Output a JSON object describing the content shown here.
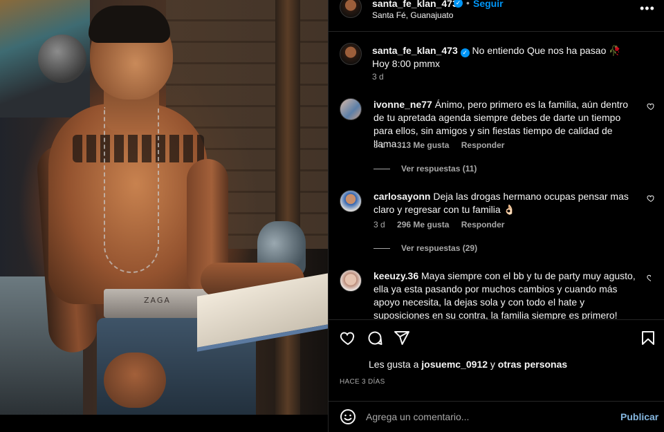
{
  "header": {
    "username": "santa_fe_klan_473",
    "verified_icon": "verified-badge-icon",
    "separator": "•",
    "follow_label": "Seguir",
    "location": "Santa Fé, Guanajuato",
    "more_icon": "more-options-icon",
    "more_glyph": "•••"
  },
  "photo": {
    "brand_text": "ZAGA"
  },
  "caption": {
    "username": "santa_fe_klan_473",
    "text_line1": "No entiendo Que nos ha pasao 🥀",
    "text_line2": "Hoy 8:00 pmmx",
    "time": "3 d"
  },
  "comments": [
    {
      "username": "ivonne_ne77",
      "text": "Ánimo, pero primero es la familia, aún dentro de tu apretada agenda siempre debes de darte un tiempo para ellos, sin amigos y sin fiestas tiempo de calidad de llama...",
      "time": "3 d",
      "likes": "313 Me gusta",
      "reply": "Responder",
      "view_replies": "Ver respuestas (11)"
    },
    {
      "username": "carlosayonn",
      "text": "Deja las drogas hermano ocupas pensar mas claro y regresar con tu familia 👌🏻",
      "time": "3 d",
      "likes": "296 Me gusta",
      "reply": "Responder",
      "view_replies": "Ver respuestas (29)"
    },
    {
      "username": "keeuzy.36",
      "text": "Maya siempre con el bb y tu de party muy agusto, ella ya esta pasando por muchos cambios y cuando más apoyo necesita, la dejas sola y con todo el hate y suposiciones en su contra, la familia siempre es primero!"
    }
  ],
  "actions": {
    "like_icon": "heart-icon",
    "comment_icon": "comment-icon",
    "share_icon": "share-icon",
    "save_icon": "bookmark-icon"
  },
  "likes": {
    "prefix": "Les gusta a ",
    "user": "josuemc_0912",
    "middle": " y ",
    "others": "otras personas"
  },
  "post_date": "HACE 3 DÍAS",
  "add_comment": {
    "emoji_icon": "emoji-icon",
    "placeholder": "Agrega un comentario...",
    "post_label": "Publicar"
  },
  "colors": {
    "background": "#000000",
    "text": "#f5f5f5",
    "secondary": "#a8a8a8",
    "link_blue": "#0095f6",
    "divider": "#262626"
  }
}
